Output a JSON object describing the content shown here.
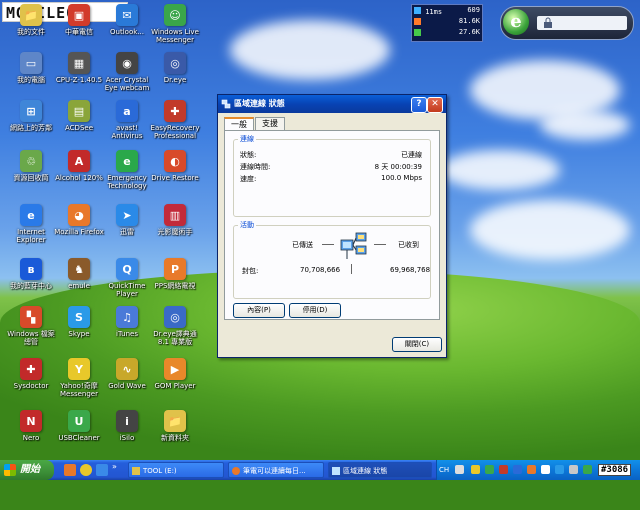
{
  "logo": {
    "text": "MOBILE01"
  },
  "netmeter": {
    "rows": [
      {
        "label": "11ms",
        "value": "609"
      },
      {
        "label": "",
        "value": "81.6K"
      },
      {
        "label": "",
        "value": "27.6K"
      }
    ],
    "colors": [
      "#3fb0ff",
      "#ff7a2a",
      "#46c94a"
    ]
  },
  "desktop_icons": [
    {
      "name": "我的文件",
      "color": "#e0c24a",
      "glyph": "📁"
    },
    {
      "name": "中華電信",
      "color": "#d23b2b",
      "glyph": "▣"
    },
    {
      "name": "Outlook...",
      "color": "#2a7ad8",
      "glyph": "✉"
    },
    {
      "name": "Windows Live\nMessenger",
      "color": "#3aa64a",
      "glyph": "☺"
    },
    {
      "name": "我的電腦",
      "color": "#5e86c8",
      "glyph": "▭"
    },
    {
      "name": "CPU-Z-1.40.5",
      "color": "#555",
      "glyph": "▦"
    },
    {
      "name": "Acer Crystal\nEye webcam",
      "color": "#444",
      "glyph": "◉"
    },
    {
      "name": "Dr.eye",
      "color": "#3a5aa8",
      "glyph": "◎"
    },
    {
      "name": "網路上的芳鄰",
      "color": "#3f86d8",
      "glyph": "⊞"
    },
    {
      "name": "ACDSee",
      "color": "#8aa53a",
      "glyph": "▤"
    },
    {
      "name": "avast! Antivirus",
      "color": "#2a6ad8",
      "glyph": "a"
    },
    {
      "name": "EasyRecovery\nProfessional",
      "color": "#c23a2a",
      "glyph": "✚"
    },
    {
      "name": "資源回收筒",
      "color": "#6aa84a",
      "glyph": "♲"
    },
    {
      "name": "Alcohol 120%",
      "color": "#c22a2a",
      "glyph": "A"
    },
    {
      "name": "Emergency\nTechnology",
      "color": "#2aa84a",
      "glyph": "e"
    },
    {
      "name": "Drive Restore",
      "color": "#d84a2a",
      "glyph": "◐"
    },
    {
      "name": "Internet\nExplorer",
      "color": "#2a7ae8",
      "glyph": "e"
    },
    {
      "name": "Mozilla Firefox",
      "color": "#e8782a",
      "glyph": "◕"
    },
    {
      "name": "迅雷",
      "color": "#2a8ae8",
      "glyph": "➤"
    },
    {
      "name": "光影魔術手",
      "color": "#c22a3a",
      "glyph": "▥"
    },
    {
      "name": "我的藍芽中心",
      "color": "#1a5ad8",
      "glyph": "ʙ"
    },
    {
      "name": "emule",
      "color": "#8a5a2a",
      "glyph": "♞"
    },
    {
      "name": "QuickTime\nPlayer",
      "color": "#3a8ae8",
      "glyph": "Q"
    },
    {
      "name": "PPS網絡電視",
      "color": "#e87a2a",
      "glyph": "P"
    },
    {
      "name": "Windows 檔案\n總管",
      "color": "#d84a2a",
      "glyph": "▚"
    },
    {
      "name": "Skype",
      "color": "#2a9ae8",
      "glyph": "S"
    },
    {
      "name": "iTunes",
      "color": "#4a7ad8",
      "glyph": "♫"
    },
    {
      "name": "Dr.eye譯典通\n8.1 專業版",
      "color": "#3a6ac8",
      "glyph": "◎"
    },
    {
      "name": "Sysdoctor",
      "color": "#c22a2a",
      "glyph": "✚"
    },
    {
      "name": "Yahoo!奇摩\nMessenger",
      "color": "#e8c82a",
      "glyph": "Y"
    },
    {
      "name": "Gold Wave",
      "color": "#c8a82a",
      "glyph": "∿"
    },
    {
      "name": "GOM Player",
      "color": "#e8882a",
      "glyph": "▶"
    },
    {
      "name": "Nero",
      "color": "#c22a2a",
      "glyph": "N"
    },
    {
      "name": "USBCleaner",
      "color": "#3aa84a",
      "glyph": "U"
    },
    {
      "name": "iSilo",
      "color": "#444",
      "glyph": "i"
    },
    {
      "name": "新資料夾",
      "color": "#e0c24a",
      "glyph": "📁"
    }
  ],
  "dialog": {
    "title": "區域連線 狀態",
    "help_label": "?",
    "close_label": "✕",
    "tabs": [
      "一般",
      "支援"
    ],
    "connection": {
      "group_title": "連線",
      "rows": [
        {
          "key": "狀態:",
          "value": "已連線"
        },
        {
          "key": "連線時間:",
          "value": "8 天 00:00:39"
        },
        {
          "key": "速度:",
          "value": "100.0 Mbps"
        }
      ]
    },
    "activity": {
      "group_title": "活動",
      "sent_label": "已傳送",
      "received_label": "已收到",
      "packets_label": "封包:",
      "sent_value": "70,708,666",
      "received_value": "69,968,768"
    },
    "properties_button": "內容(P)",
    "disable_button": "停用(D)",
    "close_button": "關閉(C)"
  },
  "taskbar": {
    "start_label": "開始",
    "buttons": [
      {
        "label": "TOOL (E:)",
        "active": false
      },
      {
        "label": "筆電可以連續每日...",
        "active": false
      },
      {
        "label": "區域連線 狀態",
        "active": true
      }
    ],
    "tray_lang": "CH",
    "badge": "#3086"
  }
}
